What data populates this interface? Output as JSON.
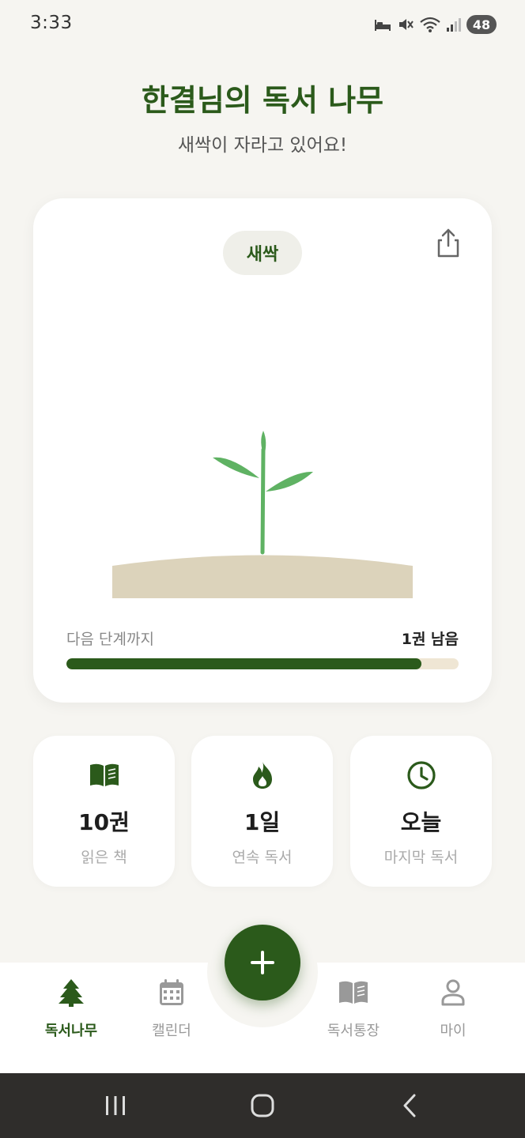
{
  "status_bar": {
    "time": "3:33",
    "battery": "48",
    "icons": [
      "sleep-icon",
      "mute-icon",
      "wifi-icon",
      "signal-icon",
      "battery-icon"
    ]
  },
  "header": {
    "title": "한결님의 독서 나무",
    "subtitle": "새싹이 자라고 있어요!"
  },
  "tree_card": {
    "stage": "새싹",
    "share_icon": "share-icon",
    "progress_label": "다음 단계까지",
    "progress_value": "1권 남음",
    "progress_fraction": 0.905
  },
  "stats": [
    {
      "icon": "book-icon",
      "value": "10권",
      "label": "읽은 책"
    },
    {
      "icon": "flame-icon",
      "value": "1일",
      "label": "연속 독서"
    },
    {
      "icon": "clock-icon",
      "value": "오늘",
      "label": "마지막 독서"
    }
  ],
  "bottom_nav": {
    "items": [
      {
        "icon": "tree-icon",
        "label": "독서나무",
        "active": true
      },
      {
        "icon": "calendar-icon",
        "label": "캘린더",
        "active": false
      },
      {
        "icon": "book-icon",
        "label": "독서통장",
        "active": false
      },
      {
        "icon": "person-icon",
        "label": "마이",
        "active": false
      }
    ],
    "fab_icon": "plus-icon"
  },
  "system_nav": [
    "recent-apps-icon",
    "home-icon",
    "back-icon"
  ],
  "colors": {
    "brand_green": "#2b5a1b",
    "sprout_green": "#5fb263",
    "soil": "#dcd3bb",
    "background": "#f6f5f1",
    "progress_track": "#efe6d4"
  }
}
